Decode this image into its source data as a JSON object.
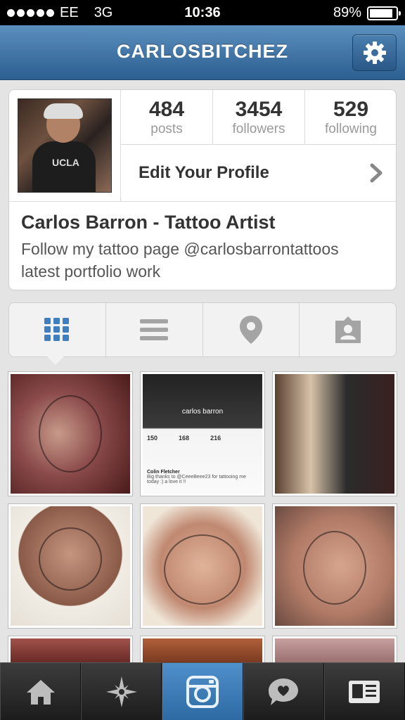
{
  "status_bar": {
    "carrier": "EE",
    "network": "3G",
    "time": "10:36",
    "battery_percent": "89%",
    "battery_level": 0.89,
    "signal_bars": 5
  },
  "nav": {
    "title": "CARLOSBITCHEZ",
    "settings_icon": "gear-icon"
  },
  "profile": {
    "stats": [
      {
        "value": "484",
        "label": "posts"
      },
      {
        "value": "3454",
        "label": "followers"
      },
      {
        "value": "529",
        "label": "following"
      }
    ],
    "edit_label": "Edit Your Profile",
    "name": "Carlos Barron - Tattoo Artist",
    "bio_line1": "Follow my tattoo page @carlosbarrontattoos",
    "bio_line2": "latest portfolio work",
    "avatar_shirt_text": "UCLA"
  },
  "view_tabs": [
    {
      "name": "grid",
      "icon": "grid-icon",
      "selected": true
    },
    {
      "name": "list",
      "icon": "list-icon",
      "selected": false
    },
    {
      "name": "map",
      "icon": "location-pin-icon",
      "selected": false
    },
    {
      "name": "tagged",
      "icon": "tagged-person-icon",
      "selected": false
    }
  ],
  "thumbnail_embedded": {
    "name": "carlos barron",
    "stats": [
      "150",
      "168",
      "216"
    ],
    "comment_author": "Colin Fletcher",
    "comment_text": "Big thanks to @CeeeBeee23 for tattooing me today :) a love it !!"
  },
  "tabbar": [
    {
      "name": "home",
      "icon": "home-icon",
      "active": false
    },
    {
      "name": "explore",
      "icon": "explore-star-icon",
      "active": false
    },
    {
      "name": "camera",
      "icon": "camera-icon",
      "active": true
    },
    {
      "name": "news",
      "icon": "speech-heart-icon",
      "active": false
    },
    {
      "name": "profile",
      "icon": "profile-card-icon",
      "active": false
    }
  ],
  "colors": {
    "nav_blue": "#2c5f91",
    "active_tab_blue": "#2d6aa4",
    "grid_icon_blue": "#3f7fc0"
  }
}
